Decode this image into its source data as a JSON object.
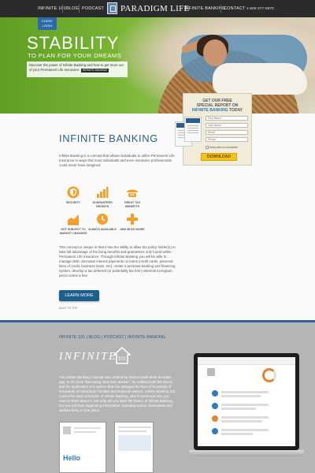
{
  "nav": {
    "left_items": [
      "INFINITE 101",
      "BLOG",
      "PODCAST"
    ],
    "logo": "PARADIGM LIFE",
    "right_items": [
      "INFINITE BANKING",
      "CONTACT"
    ],
    "phone": "1-800-277-0670"
  },
  "hero": {
    "client_login": "CLIENT LOGIN",
    "title": "STABILITY",
    "subtitle": "TO PLAN FOR YOUR DREAMS",
    "box_text": "Discover the power of Infinite Banking and how to get more out of your Permanent Life Insurance.",
    "box_button": "INFINITE BANKING"
  },
  "report": {
    "line1": "GET OUR FREE",
    "line2": "SPECIAL REPORT ON",
    "line3_blue": "INFINITE BANKING",
    "line3_rest": " TODAY",
    "fields": [
      "First Name",
      "Last Name",
      "Email",
      "Phone"
    ],
    "checkbox": "Subscribe to newsletter",
    "button": "DOWNLOAD"
  },
  "infinite_banking": {
    "title": "INFINITE BANKING",
    "intro": "Infinite Banking is a concept that allows individuals to utilize Permanent Life Insurance in ways that most individuals and even insurance professionals could never have imagined.",
    "features": [
      {
        "label": "SECURITY",
        "icon": "shield-icon"
      },
      {
        "label": "GUARANTEED GROWTH",
        "icon": "bar-chart-icon"
      },
      {
        "label": "GREAT TAX BENEFITS",
        "icon": "umbrella-icon"
      },
      {
        "label": "NOT SUBJECT TO MARKET CHANGES",
        "icon": "trend-chart-icon"
      },
      {
        "label": "ALWAYS AVAILABLE",
        "icon": "clock-icon"
      },
      {
        "label": "AND MUCH MORE",
        "icon": "plus-icon"
      }
    ],
    "body": "This concept is unique in that it has the ability to allow the policy holder(s) to take full advantage of the living benefits and guarantees only found within Permanent Life Insurance. Through Infinite Banking you will be able to: manage debt, decrease interest payments on loans (credit cards, personal lines of credit, business loans, etc), create a personal banking and financing system, develop a tax deferred (or potentially tax free) retirement program, just to name a few.",
    "learn_more": "LEARN MORE",
    "back_to_top": "BACK TO TOP"
  },
  "section101": {
    "nav": [
      "INFINITE 101",
      "BLOG",
      "PODCAST",
      "INFINITE BANKING"
    ],
    "title": "INFINITE",
    "badge": "101",
    "text": "The Infinite Banking Concept was created by Nelson Nash three decades ago. In his book \"Becoming Your Own Banker\", he outlines both the theory and the application of a system that has changed the lives of hundreds of thousands of individuals, families and business owners. Infinite Banking 101 covers the basic principles of Infinite Banking, why it works and why you need to learn about it. Not only will you learn the basics of Infinite Banking, but you will have supporting information, including videos, illustrations and website links, in one place.",
    "phone_greeting": "Hello"
  }
}
